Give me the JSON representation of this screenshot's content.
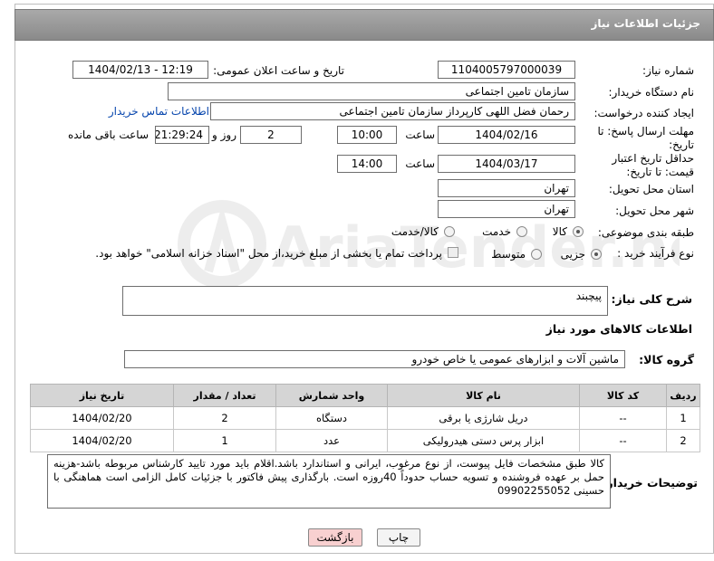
{
  "title": "جزئیات اطلاعات نیاز",
  "fields": {
    "need_number_label": "شماره نیاز:",
    "need_number": "1104005797000039",
    "announce_label": "تاریخ و ساعت اعلان عمومی:",
    "announce_value": "1404/02/13 - 12:19",
    "buyer_org_label": "نام دستگاه خریدار:",
    "buyer_org": "سازمان تامین اجتماعی",
    "requester_label": "ایجاد کننده درخواست:",
    "requester": "رحمان فضل اللهی کارپرداز سازمان تامین اجتماعی",
    "contact_link": "اطلاعات تماس خریدار",
    "deadline_label": "مهلت ارسال پاسخ: تا تاریخ:",
    "deadline_date": "1404/02/16",
    "time_label": "ساعت",
    "deadline_time": "10:00",
    "days_value": "2",
    "days_label": "روز و",
    "remaining_time": "21:29:24",
    "remaining_label": "ساعت باقی مانده",
    "validity_label": "حداقل تاریخ اعتبار قیمت: تا تاریخ:",
    "validity_date": "1404/03/17",
    "validity_time": "14:00",
    "province_label": "استان محل تحویل:",
    "province": "تهران",
    "city_label": "شهر محل تحویل:",
    "city": "تهران",
    "category_label": "طبقه بندی موضوعی:",
    "category_options": [
      "کالا",
      "خدمت",
      "کالا/خدمت"
    ],
    "process_label": "نوع فرآیند خرید :",
    "process_options": [
      "جزیی",
      "متوسط"
    ],
    "payment_note": "پرداخت تمام یا بخشی از مبلغ خرید،از محل \"اسناد خزانه اسلامی\" خواهد بود."
  },
  "description": {
    "label": "شرح کلی نیاز:",
    "value": "پیچبند"
  },
  "goods_section": {
    "title": "اطلاعات کالاهای مورد نیاز",
    "group_label": "گروه کالا:",
    "group_value": "ماشین آلات و ابزارهای عمومی یا خاص خودرو"
  },
  "table": {
    "headers": [
      "ردیف",
      "کد کالا",
      "نام کالا",
      "واحد شمارش",
      "تعداد / مقدار",
      "تاریخ نیاز"
    ],
    "rows": [
      [
        "1",
        "--",
        "دریل شارژی یا برقی",
        "دستگاه",
        "2",
        "1404/02/20"
      ],
      [
        "2",
        "--",
        "ابزار پرس دستی هیدرولیکی",
        "عدد",
        "1",
        "1404/02/20"
      ]
    ]
  },
  "buyer_notes": {
    "label": "توضیحات خریدار:",
    "value": "کالا طبق مشخصات فایل پیوست، از نوع مرغوب، ایرانی و استاندارد باشد.اقلام باید مورد تایید کارشناس مربوطه باشد-هزینه حمل بر عهده فروشنده و تسویه حساب حدوداً 40روزه است. بارگذاری پیش فاکتور با جزئیات کامل الزامی است هماهنگی با حسینی 09902255052"
  },
  "buttons": {
    "print": "چاپ",
    "back": "بازگشت"
  },
  "watermark": "AriaTender.net",
  "colors": {
    "titlebar": "#999999",
    "link": "#0645ad",
    "back_button": "#f8d0d0"
  }
}
